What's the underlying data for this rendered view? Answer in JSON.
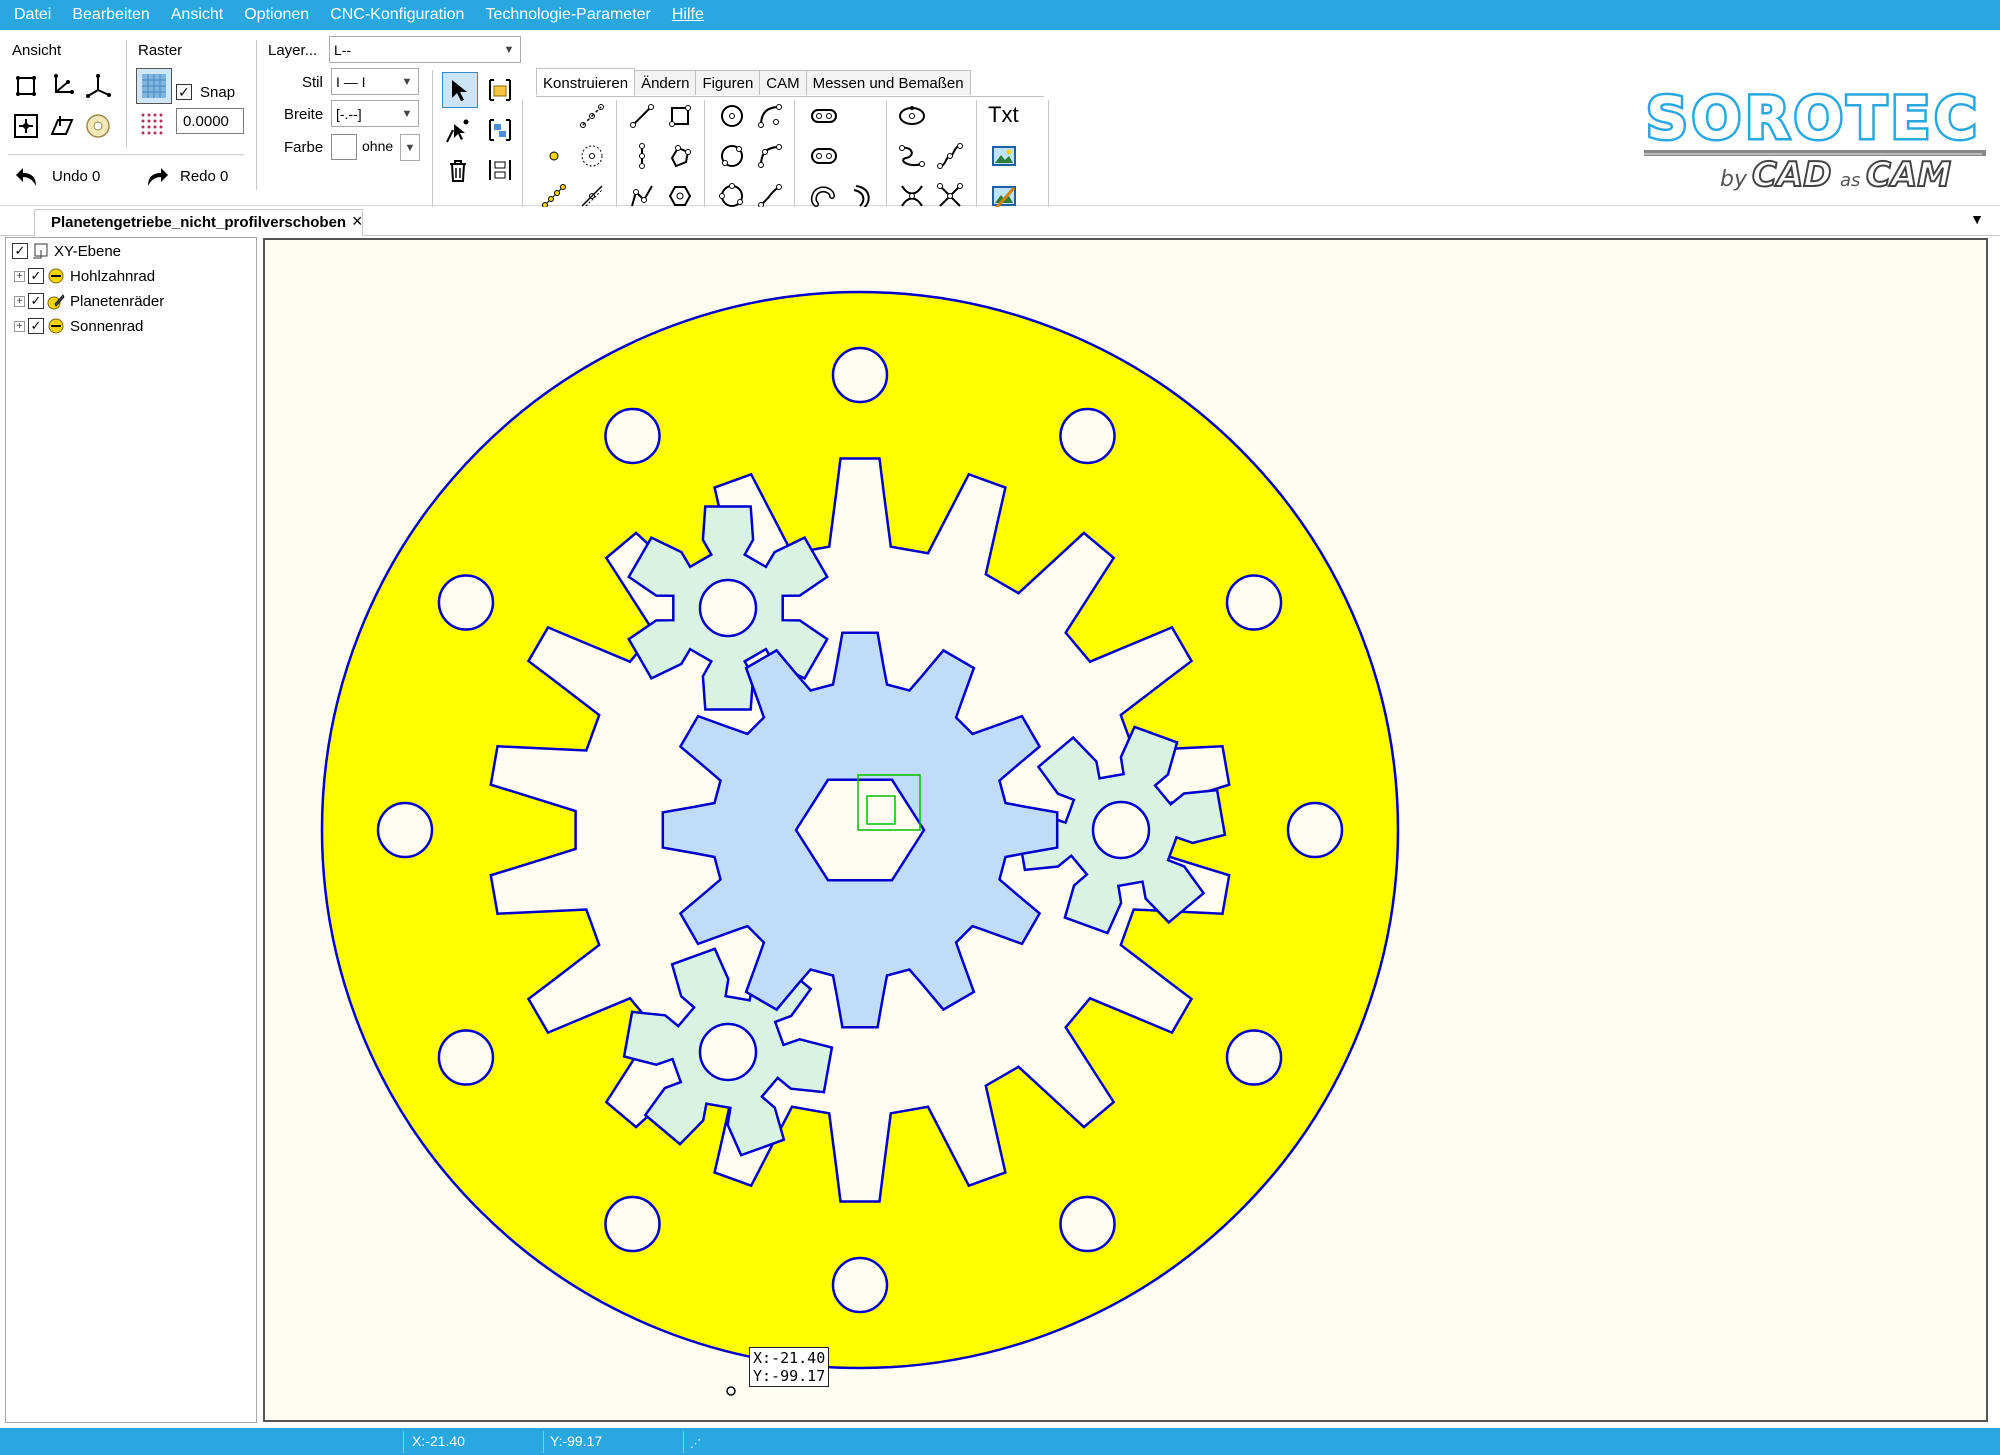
{
  "menu": {
    "items": [
      "Datei",
      "Bearbeiten",
      "Ansicht",
      "Optionen",
      "CNC-Konfiguration",
      "Technologie-Parameter",
      "Hilfe"
    ]
  },
  "ribbon": {
    "ansicht_label": "Ansicht",
    "raster_label": "Raster",
    "snap_label": "Snap",
    "snap_checked": "✓",
    "raster_value": "0.0000",
    "undo_label": "Undo 0",
    "redo_label": "Redo 0",
    "layer_label": "Layer...",
    "layer_value": "L--",
    "stil_label": "Stil",
    "stil_value": "I — I",
    "breite_label": "Breite",
    "breite_value": "[-.--]",
    "farbe_label": "Farbe",
    "farbe_value": "ohne",
    "txt_label": "Txt",
    "tabs": [
      "Konstruieren",
      "Ändern",
      "Figuren",
      "CAM",
      "Messen und Bemaßen"
    ]
  },
  "logo": {
    "brand": "SOROTEC",
    "tagline_prefix": "by",
    "tagline": "CAD",
    "tagline_mid": "as",
    "tagline_suffix": "CAM"
  },
  "document": {
    "tab_title": "Planetengetriebe_nicht_profilverschoben",
    "close_glyph": "×",
    "dropdown_glyph": "▼"
  },
  "tree": {
    "root": "XY-Ebene",
    "layers": [
      "Hohlzahnrad",
      "Planetenräder",
      "Sonnenrad"
    ]
  },
  "cursor_tooltip": {
    "x_text": "X:-21.40",
    "y_text": "Y:-99.17"
  },
  "status": {
    "x_text": "X:-21.40",
    "y_text": "Y:-99.17"
  },
  "colors": {
    "accent": "#29a8e0",
    "ring_fill": "#ffff00",
    "outline": "#0000cc",
    "planet_fill": "#d8f3e3",
    "sun_fill": "#c0dcf8",
    "canvas_bg": "#fffdf2",
    "marker": "#00c000"
  }
}
